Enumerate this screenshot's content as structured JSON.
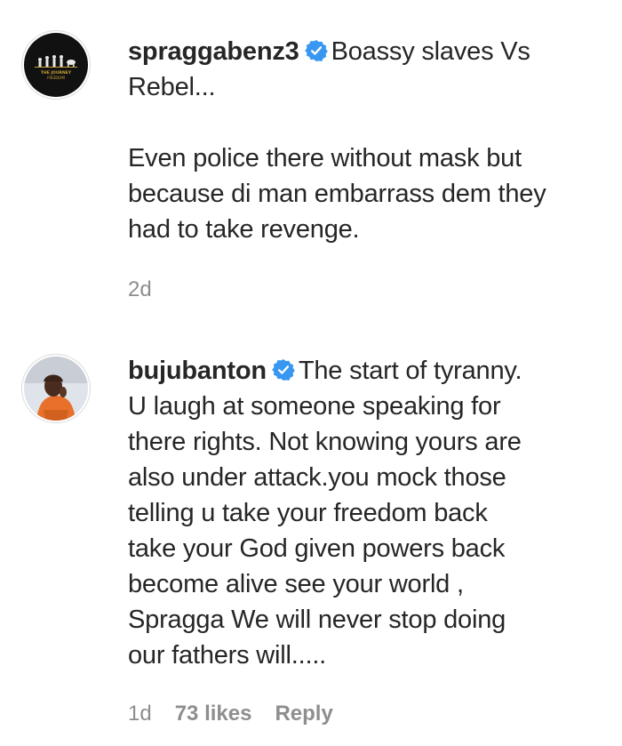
{
  "comments": [
    {
      "username": "spraggabenz3",
      "verified": true,
      "avatar_icon": "journey-logo-avatar",
      "avatar_text": "THE JOURNEY FREEDOM",
      "first_line": "Boassy slaves Vs",
      "lines": [
        "Rebel...",
        "",
        "Even police there without mask but",
        "because di man embarrass dem they",
        "had to take revenge."
      ],
      "time": "2d"
    },
    {
      "username": "bujubanton",
      "verified": true,
      "avatar_icon": "person-photo-avatar",
      "first_line": "The start of tyranny.",
      "lines": [
        "U laugh at someone speaking for",
        "there rights. Not knowing yours are",
        "also under attack.you mock those",
        "telling u take your freedom back",
        "take your God given powers back",
        "become alive see your world ,",
        "Spragga We will never stop doing",
        "our fathers will....."
      ],
      "time": "1d",
      "likes": "73 likes",
      "reply_label": "Reply"
    }
  ],
  "colors": {
    "text": "#262626",
    "muted": "#8e8e8e",
    "verified_blue": "#3897f0"
  }
}
